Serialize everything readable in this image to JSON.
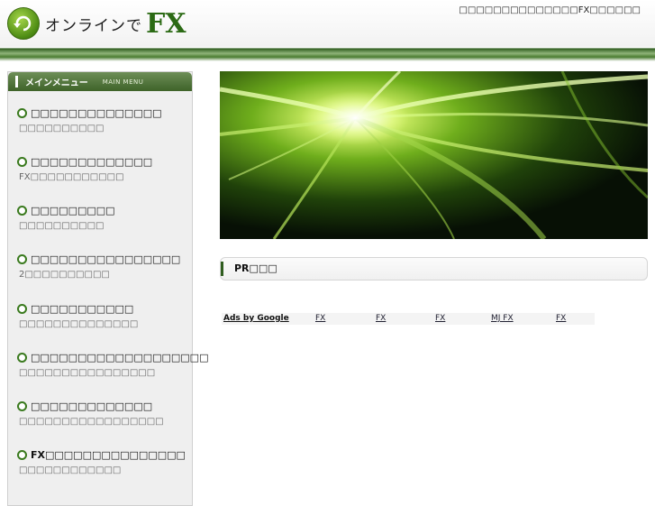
{
  "header": {
    "logo_jp": "オンラインで",
    "logo_fx": "FX",
    "tagline": "□□□□□□□□□□□□□□FX□□□□□□"
  },
  "sidebar": {
    "title": "メインメニュー",
    "subtitle": "MAIN MENU",
    "items": [
      {
        "label": "□□□□□□□□□□□□□□",
        "desc": "□□□□□□□□□□"
      },
      {
        "label": "□□□□□□□□□□□□□",
        "desc": "FX□□□□□□□□□□□"
      },
      {
        "label": "□□□□□□□□□",
        "desc": "□□□□□□□□□□"
      },
      {
        "label": "□□□□□□□□□□□□□□□□",
        "desc": "2□□□□□□□□□□"
      },
      {
        "label": "□□□□□□□□□□□",
        "desc": "□□□□□□□□□□□□□□"
      },
      {
        "label": "□□□□□□□□□□□□□□□□□□□",
        "desc": "□□□□□□□□□□□□□□□□"
      },
      {
        "label": "□□□□□□□□□□□□□",
        "desc": "□□□□□□□□□□□□□□□□□"
      },
      {
        "label": "FX□□□□□□□□□□□□□□□",
        "desc": "□□□□□□□□□□□□"
      }
    ]
  },
  "main": {
    "pr_title": "PR□□□",
    "ads": {
      "label": "Ads by Google",
      "links": [
        "FX",
        "FX",
        "FX",
        "MJ FX",
        "FX"
      ]
    }
  },
  "colors": {
    "accent_green": "#2f5d1f",
    "sidebar_bg": "#efefef"
  }
}
